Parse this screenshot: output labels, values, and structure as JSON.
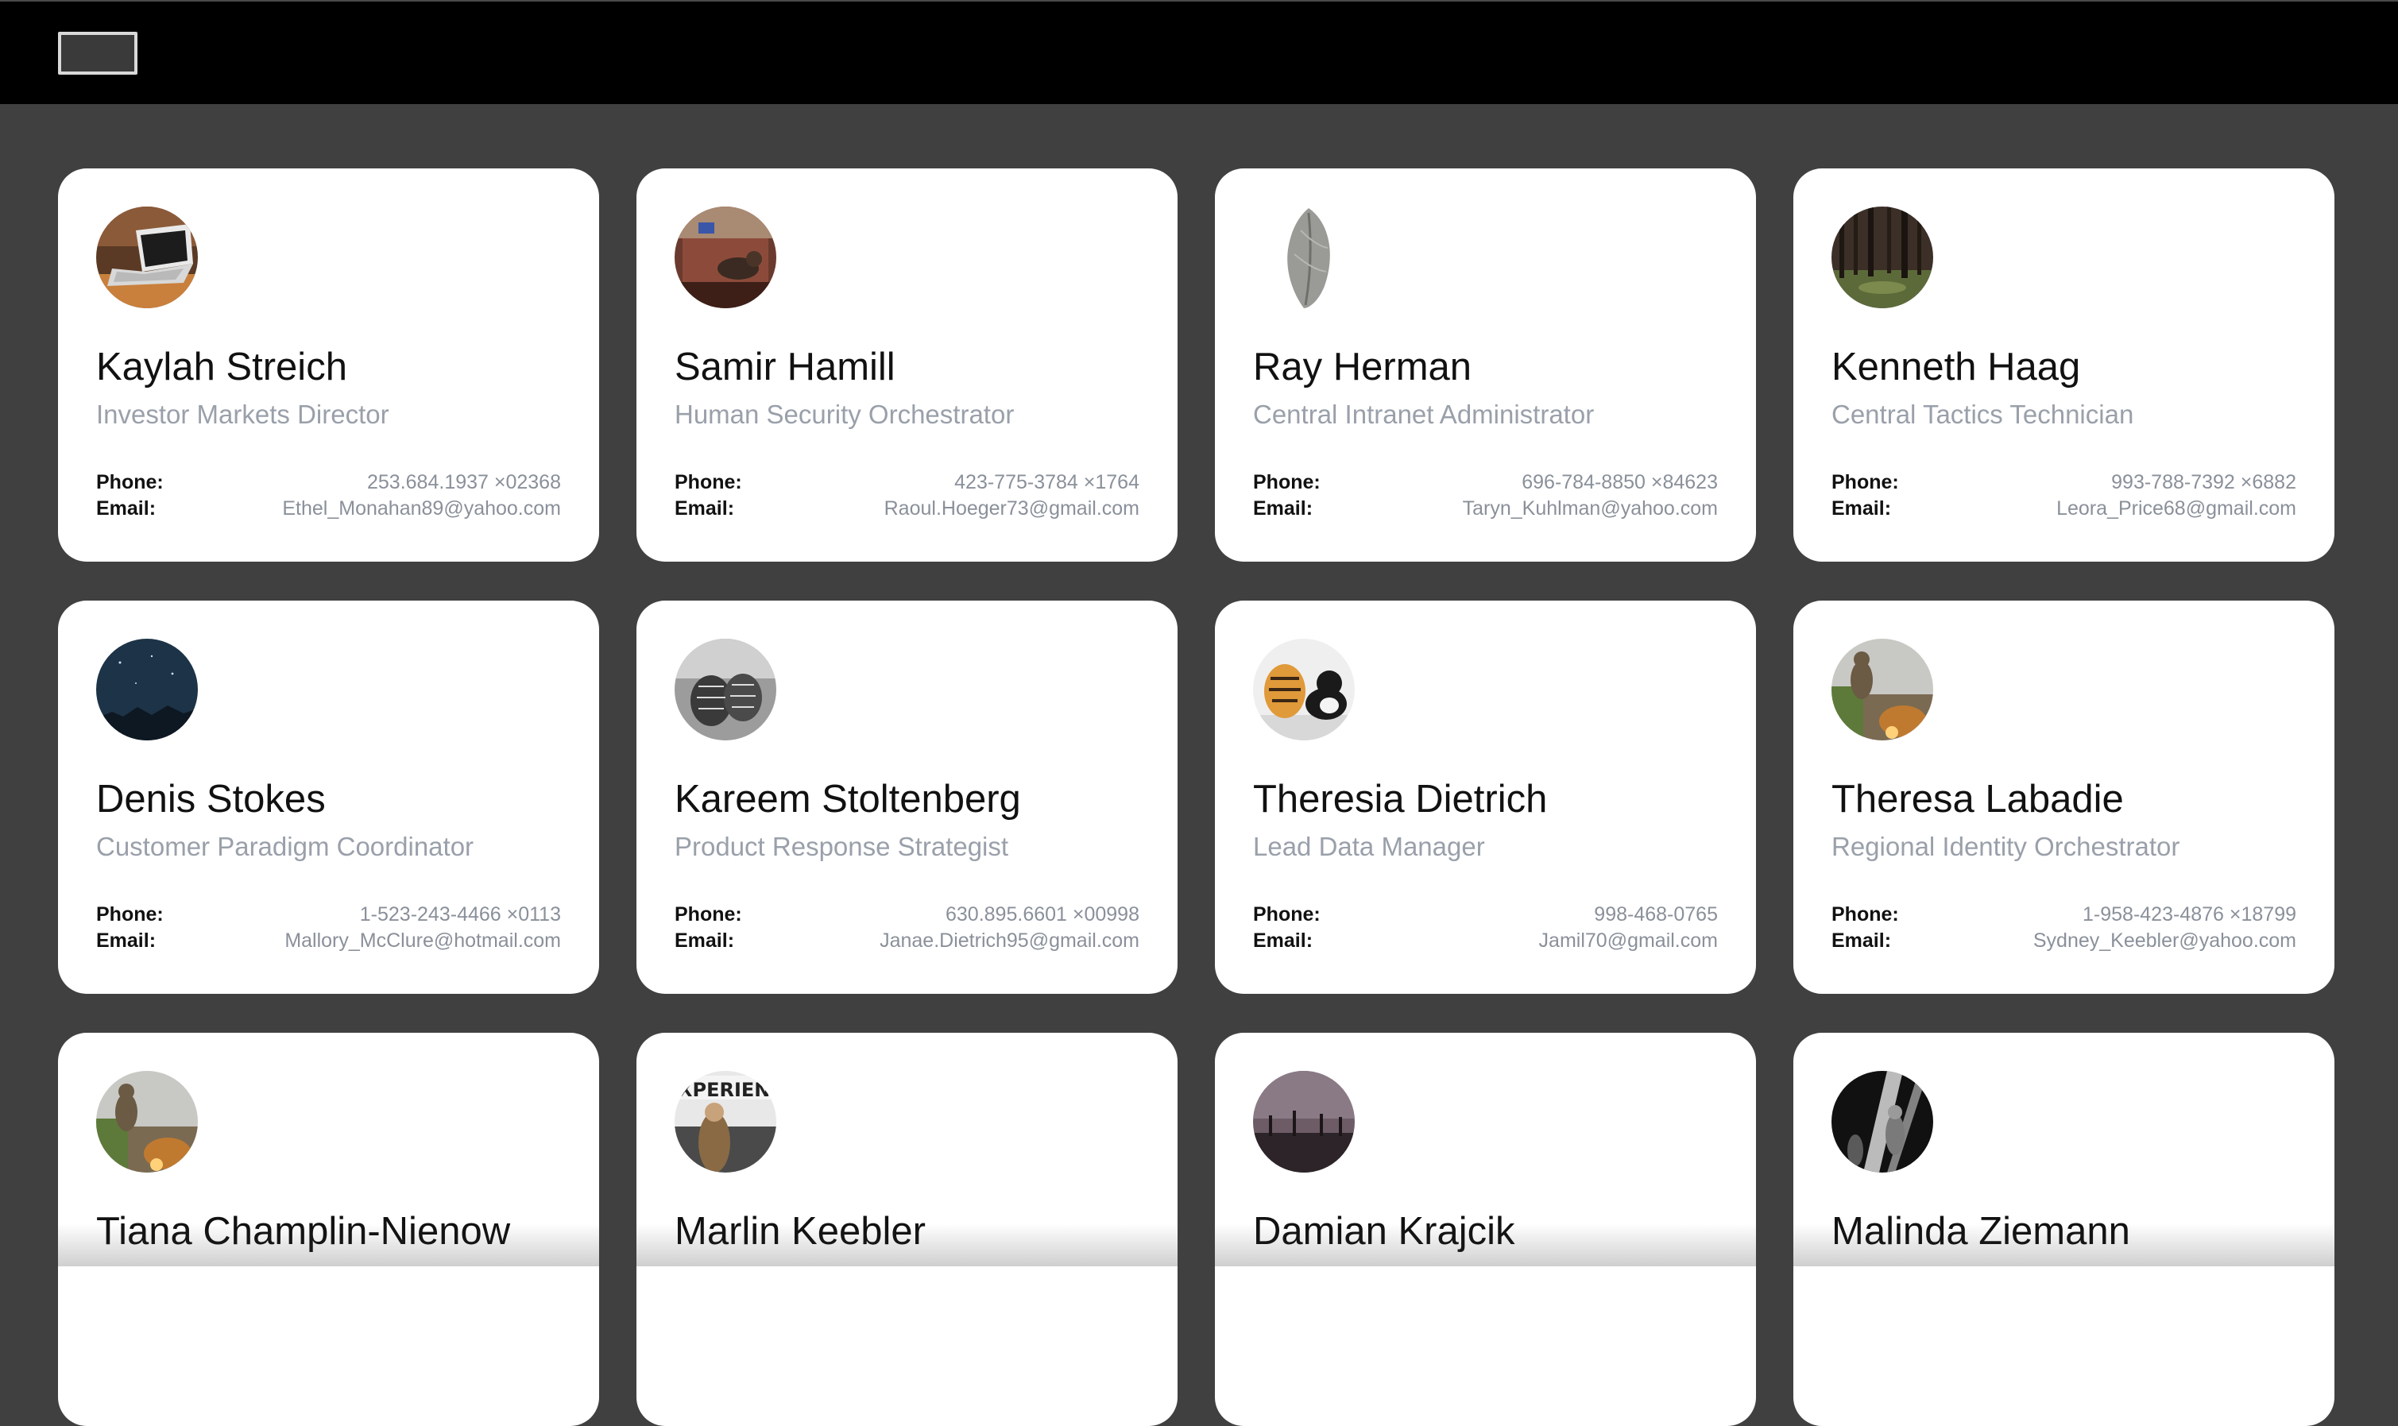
{
  "header": {
    "menu_button": "menu-button"
  },
  "contacts": [
    {
      "name": "Kaylah Streich",
      "role": "Investor Markets Director",
      "phone_label": "Phone:",
      "phone": "253.684.1937 ×02368",
      "email_label": "Email:",
      "email": "Ethel_Monahan89@yahoo.com",
      "avatar": "laptop-photo"
    },
    {
      "name": "Samir Hamill",
      "role": "Human Security Orchestrator",
      "phone_label": "Phone:",
      "phone": "423-775-3784 ×1764",
      "email_label": "Email:",
      "email": "Raoul.Hoeger73@gmail.com",
      "avatar": "cat-on-couch-photo"
    },
    {
      "name": "Ray Herman",
      "role": "Central Intranet Administrator",
      "phone_label": "Phone:",
      "phone": "696-784-8850 ×84623",
      "email_label": "Email:",
      "email": "Taryn_Kuhlman@yahoo.com",
      "avatar": "leaf-photo"
    },
    {
      "name": "Kenneth Haag",
      "role": "Central Tactics Technician",
      "phone_label": "Phone:",
      "phone": "993-788-7392 ×6882",
      "email_label": "Email:",
      "email": "Leora_Price68@gmail.com",
      "avatar": "forest-photo"
    },
    {
      "name": "Denis Stokes",
      "role": "Customer Paradigm Coordinator",
      "phone_label": "Phone:",
      "phone": "1-523-243-4466 ×0113",
      "email_label": "Email:",
      "email": "Mallory_McClure@hotmail.com",
      "avatar": "night-sky-photo"
    },
    {
      "name": "Kareem Stoltenberg",
      "role": "Product Response Strategist",
      "phone_label": "Phone:",
      "phone": "630.895.6601 ×00998",
      "email_label": "Email:",
      "email": "Janae.Dietrich95@gmail.com",
      "avatar": "pinecones-photo"
    },
    {
      "name": "Theresia Dietrich",
      "role": "Lead Data Manager",
      "phone_label": "Phone:",
      "phone": "998-468-0765",
      "email_label": "Email:",
      "email": "Jamil70@gmail.com",
      "avatar": "tiger-toy-and-cat-photo"
    },
    {
      "name": "Theresa Labadie",
      "role": "Regional Identity Orchestrator",
      "phone_label": "Phone:",
      "phone": "1-958-423-4876 ×18799",
      "email_label": "Email:",
      "email": "Sydney_Keebler@yahoo.com",
      "avatar": "cat-on-wall-photo"
    },
    {
      "name": "Tiana Champlin-Nienow",
      "role": "",
      "phone_label": "",
      "phone": "",
      "email_label": "",
      "email": "",
      "avatar": "cat-on-wall-photo"
    },
    {
      "name": "Marlin Keebler",
      "role": "",
      "phone_label": "",
      "phone": "",
      "email_label": "",
      "email": "",
      "avatar": "experience-sign-photo"
    },
    {
      "name": "Damian Krajcik",
      "role": "",
      "phone_label": "",
      "phone": "",
      "email_label": "",
      "email": "",
      "avatar": "bridge-dusk-photo"
    },
    {
      "name": "Malinda Ziemann",
      "role": "",
      "phone_label": "",
      "phone": "",
      "email_label": "",
      "email": "",
      "avatar": "concert-bw-photo"
    }
  ]
}
